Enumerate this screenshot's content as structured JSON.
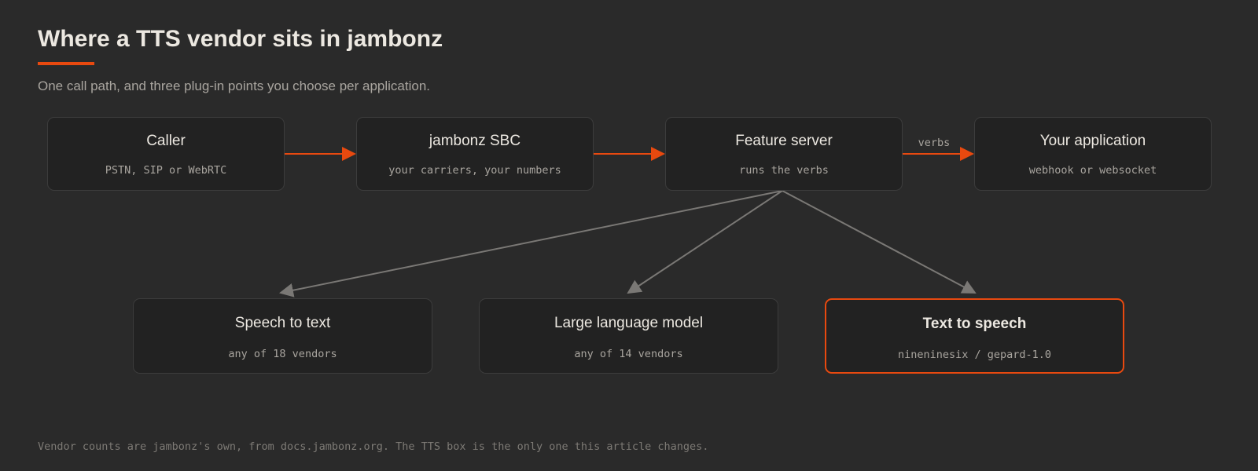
{
  "header": {
    "title": "Where a TTS vendor sits in jambonz",
    "subtitle": "One call path, and three plug-in points you choose per application."
  },
  "call_path": [
    {
      "title": "Caller",
      "detail": "PSTN, SIP or WebRTC"
    },
    {
      "title": "jambonz SBC",
      "detail": "your carriers, your numbers"
    },
    {
      "title": "Feature server",
      "detail": "runs the verbs"
    },
    {
      "title": "Your application",
      "detail": "webhook or websocket"
    }
  ],
  "path_edge_label": "verbs",
  "plugins": [
    {
      "title": "Speech to text",
      "detail": "any of 18 vendors"
    },
    {
      "title": "Large language model",
      "detail": "any of 14 vendors"
    },
    {
      "title": "Text to speech",
      "detail": "nineninesix / gepard-1.0"
    }
  ],
  "footnote": "Vendor counts are jambonz's own, from docs.jambonz.org. The TTS box is the only one this article changes.",
  "colors": {
    "background": "#2a2a2a",
    "accent": "#e8490f",
    "box_fill": "#222222",
    "box_border": "#3c3c3c",
    "text": "#ece8e1",
    "muted_text": "#a9a59f",
    "connector": "#7a7875"
  }
}
